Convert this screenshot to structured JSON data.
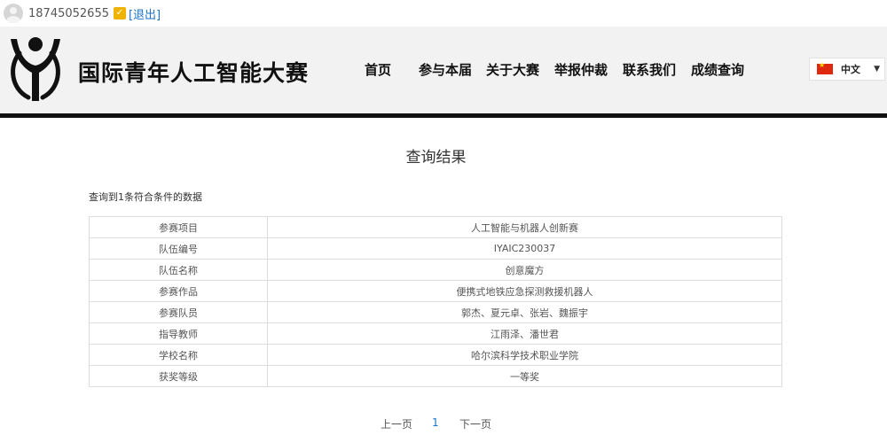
{
  "user": {
    "phone": "18745052655",
    "verified_icon": "verified-check-icon",
    "logout_label": "[退出]"
  },
  "header": {
    "logo_icon": "person-y-logo",
    "site_title": "国际青年人工智能大赛",
    "nav": [
      "首页",
      "参与本届",
      "关于大赛",
      "举报仲裁",
      "联系我们",
      "成绩查询"
    ],
    "language": {
      "flag_icon": "china-flag-icon",
      "label": "中文",
      "caret_icon": "caret-down-icon"
    }
  },
  "main": {
    "title": "查询结果",
    "result_count": "查询到1条符合条件的数据",
    "rows": [
      {
        "label": "参赛项目",
        "value": "人工智能与机器人创新赛"
      },
      {
        "label": "队伍编号",
        "value": "IYAIC230037"
      },
      {
        "label": "队伍名称",
        "value": "创意魔方"
      },
      {
        "label": "参赛作品",
        "value": "便携式地铁应急探测救援机器人"
      },
      {
        "label": "参赛队员",
        "value": "郭杰、夏元卓、张岩、魏振宇"
      },
      {
        "label": "指导教师",
        "value": "江雨泽、潘世君"
      },
      {
        "label": "学校名称",
        "value": "哈尔滨科学技术职业学院"
      },
      {
        "label": "获奖等级",
        "value": "一等奖"
      }
    ]
  },
  "pagination": {
    "prev": "上一页",
    "current": "1",
    "next": "下一页"
  },
  "colors": {
    "link": "#1a73c8",
    "header_bg": "#f2f2f2",
    "header_border": "#111111",
    "badge": "#f0b400"
  }
}
